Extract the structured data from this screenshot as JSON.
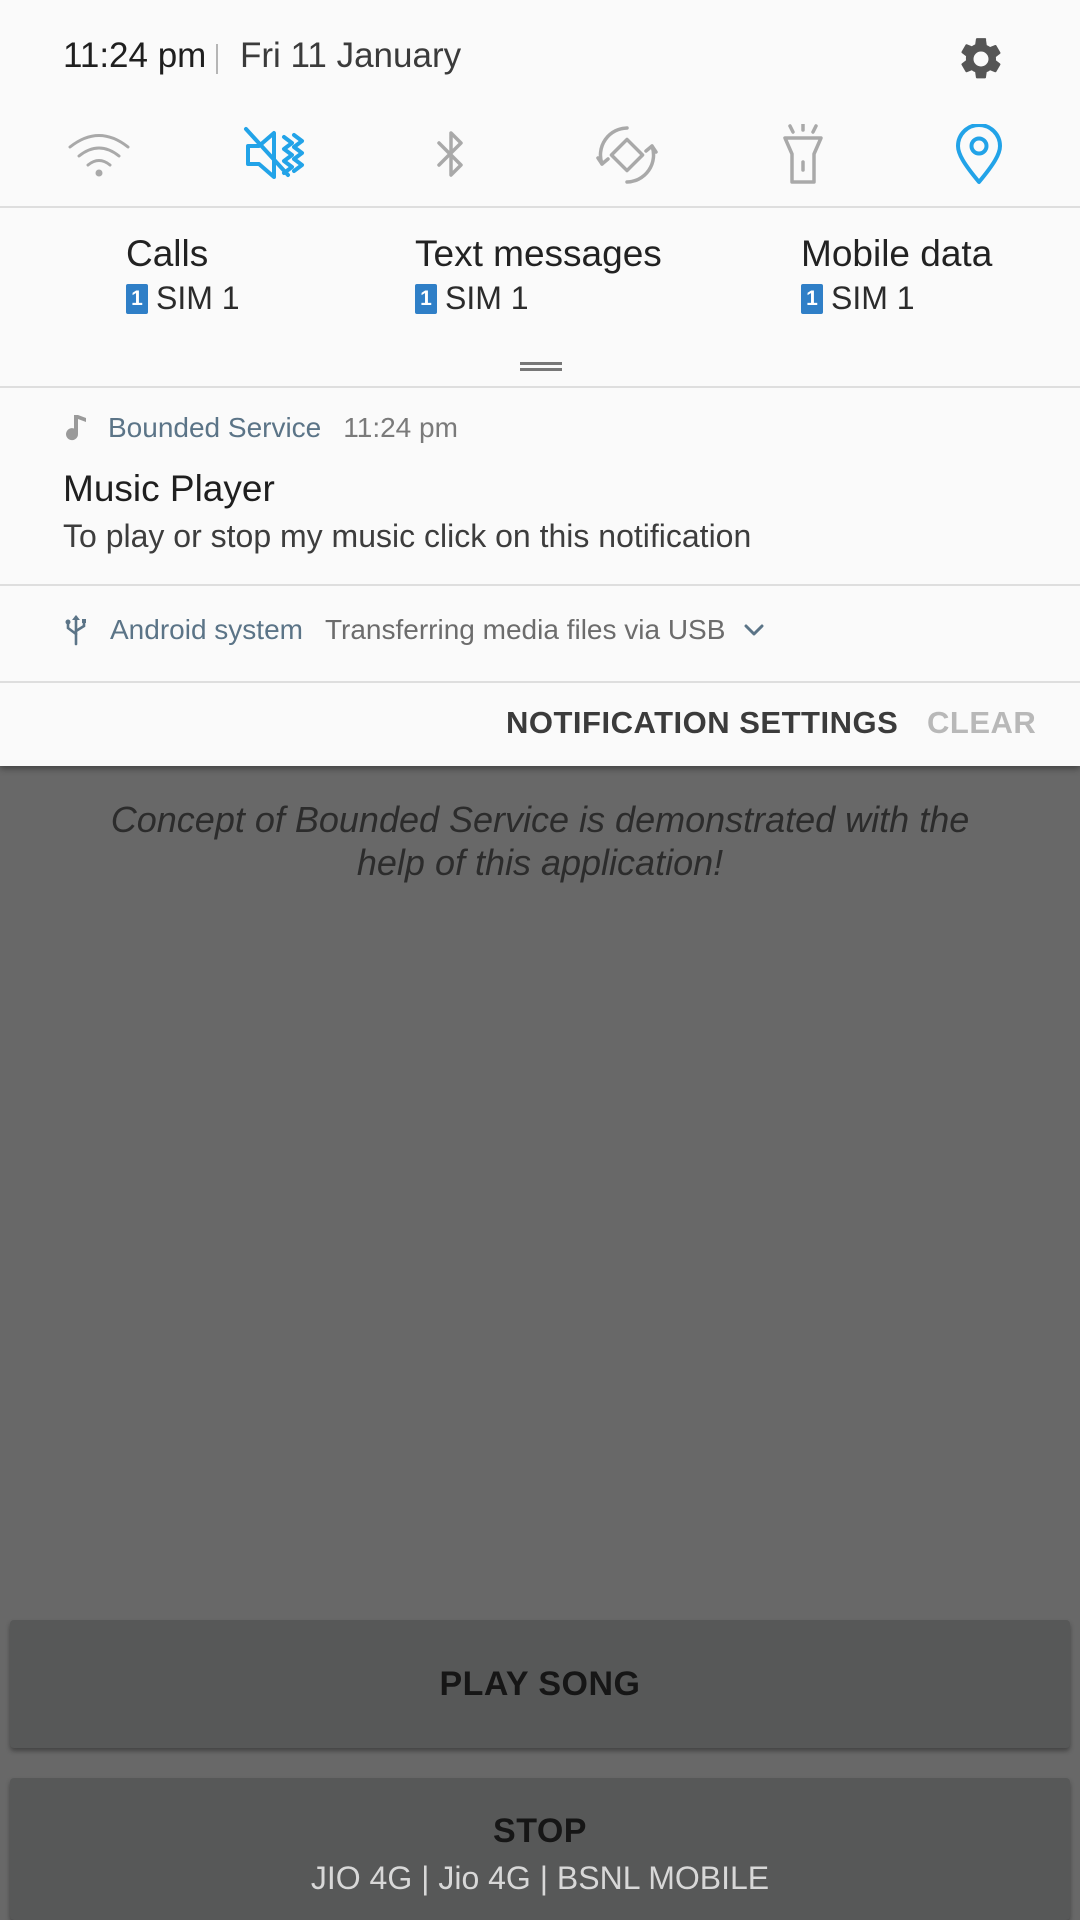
{
  "status": {
    "time": "11:24 pm",
    "date": "Fri 11 January"
  },
  "quick_settings": [
    {
      "name": "wifi-icon",
      "active": false
    },
    {
      "name": "mute-icon",
      "active": true
    },
    {
      "name": "bluetooth-icon",
      "active": false
    },
    {
      "name": "auto-rotate-icon",
      "active": false
    },
    {
      "name": "flashlight-icon",
      "active": false
    },
    {
      "name": "location-icon",
      "active": true
    }
  ],
  "sim": [
    {
      "title": "Calls",
      "badge": "1",
      "sim": "SIM 1"
    },
    {
      "title": "Text messages",
      "badge": "1",
      "sim": "SIM 1"
    },
    {
      "title": "Mobile data",
      "badge": "1",
      "sim": "SIM 1"
    }
  ],
  "notifications": {
    "music": {
      "app": "Bounded Service",
      "time": "11:24 pm",
      "title": "Music Player",
      "text": "To play or stop my music click on this notification"
    },
    "usb": {
      "app": "Android system",
      "text": "Transferring media files via USB"
    }
  },
  "actions": {
    "settings": "NOTIFICATION SETTINGS",
    "clear": "CLEAR"
  },
  "app": {
    "description": "Concept of Bounded Service is demonstrated with the help of this application!",
    "play": "PLAY SONG",
    "stop": "STOP"
  },
  "carrier": "JIO 4G | Jio 4G | BSNL MOBILE",
  "colors": {
    "accent": "#22a3e8",
    "inactive_icon": "#a9a9a9",
    "shade_bg": "#fafafa",
    "dim_bg": "#686868"
  }
}
